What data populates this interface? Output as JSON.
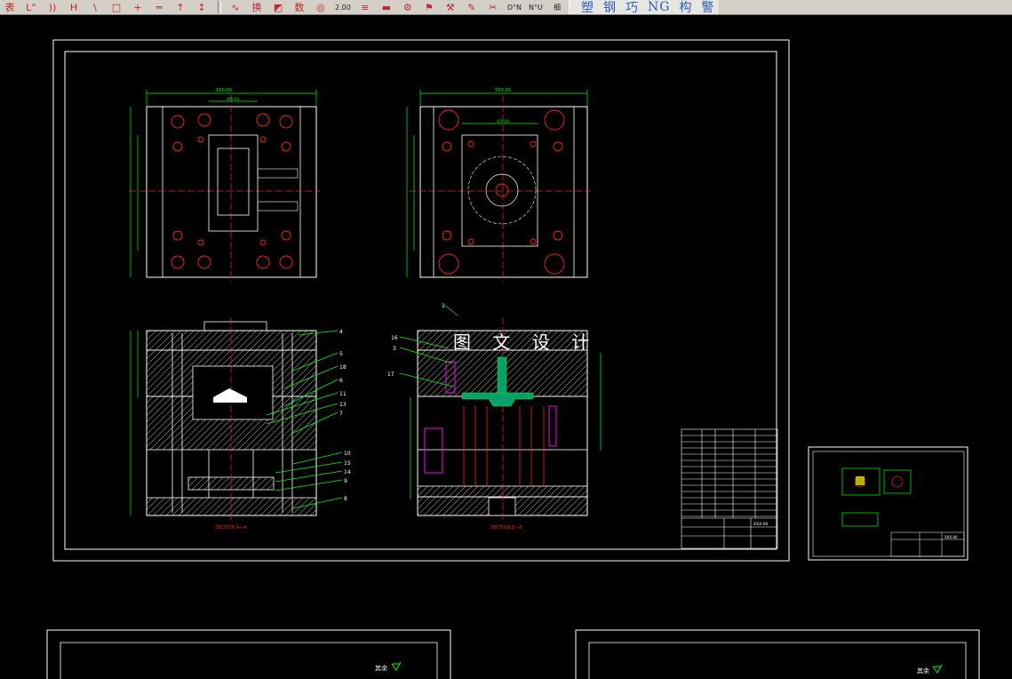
{
  "toolbar": {
    "group1": [
      {
        "name": "table-icon",
        "label": "表"
      },
      {
        "name": "chamfer-icon",
        "label": "L°"
      },
      {
        "name": "arc-icon",
        "label": "))"
      },
      {
        "name": "dimension-icon",
        "label": "H"
      },
      {
        "name": "line-icon",
        "label": "\\"
      },
      {
        "name": "rectangle-icon",
        "label": "□"
      },
      {
        "name": "cross-icon",
        "label": "+"
      },
      {
        "name": "break-line-icon",
        "label": "═"
      },
      {
        "name": "arrow-up-icon",
        "label": "↑"
      },
      {
        "name": "arrow-align-icon",
        "label": "↕"
      }
    ],
    "group2": [
      {
        "name": "transform-icon",
        "label": "∿"
      },
      {
        "name": "replace-button",
        "label": "换"
      },
      {
        "name": "fill-icon",
        "label": "◩"
      },
      {
        "name": "number-button",
        "label": "数"
      },
      {
        "name": "measure-icon",
        "label": "◎"
      },
      {
        "name": "scale-value-icon",
        "label": "2.00"
      },
      {
        "name": "layer-icon",
        "label": "≡"
      },
      {
        "name": "color-bar-icon",
        "label": "▬"
      },
      {
        "name": "tool-1-icon",
        "label": "⚙"
      },
      {
        "name": "tool-2-icon",
        "label": "⚑"
      },
      {
        "name": "tool-3-icon",
        "label": "⚒"
      },
      {
        "name": "tool-4-icon",
        "label": "✎"
      },
      {
        "name": "tool-5-icon",
        "label": "✂"
      },
      {
        "name": "dn-button",
        "label": "D°N"
      },
      {
        "name": "nu-button",
        "label": "N°U"
      },
      {
        "name": "thin-button",
        "label": "细"
      }
    ],
    "group3": [
      {
        "name": "plastic-button",
        "label": "塑"
      },
      {
        "name": "steel-button",
        "label": "钢"
      },
      {
        "name": "skill-button",
        "label": "巧"
      },
      {
        "name": "ng-button",
        "label": "NG"
      },
      {
        "name": "structure-button",
        "label": "构"
      },
      {
        "name": "alert-button",
        "label": "警"
      }
    ]
  },
  "drawing": {
    "watermark": "图 文 设 计",
    "top_view_left_dims": [
      "650.00",
      "470.00"
    ],
    "top_view_right_dims": [
      "550.00",
      "470.00"
    ],
    "section_a_label": "SECTION A—A",
    "section_b_label": "SECTION B—B",
    "part_numbers_right_a": [
      "4",
      "5",
      "18",
      "6",
      "11",
      "13",
      "7",
      "10",
      "15",
      "14",
      "9",
      "8"
    ],
    "part_numbers_left_b": [
      "16",
      "3",
      "17"
    ],
    "leader_label_top": "1",
    "title_block_code": "XXX-00",
    "mini_sheet_code": "XXX-00",
    "sheet_stamp_left": "其余",
    "sheet_stamp_right": "其余"
  },
  "colors": {
    "background": "#000000",
    "frame": "#ffffff",
    "geometry": "#ffffff",
    "dimension": "#00ff00",
    "centerline": "#ff2020",
    "hatch": "#ffffff",
    "magenta": "#ff00ff",
    "yellow": "#ffff00"
  }
}
